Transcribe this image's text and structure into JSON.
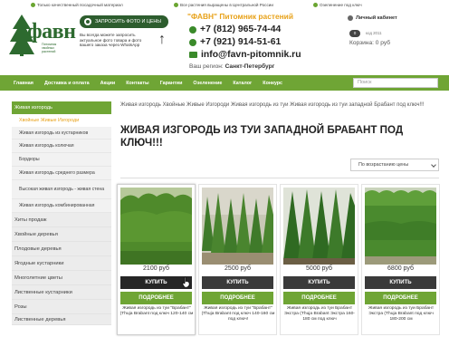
{
  "topbar": {
    "items": [
      "Только качественный посадочный материал",
      "Все растения выращены в Центральной России",
      "Озеленение под ключ"
    ]
  },
  "header": {
    "logo_text": "фавн",
    "logo_sub": "Питомник хвойных растений",
    "whatsapp_button": "ЗАПРОСИТЬ ФОТО И ЦЕНЫ",
    "whatsapp_text": "Вы всегда можете запросить актуальное фото товара и фото вашего заказа через WhatsApp",
    "brand": "\"ФАВН\" Питомник  растений",
    "phone1": "+7 (812) 965-74-44",
    "phone2": "+7 (921) 914-51-61",
    "email": "info@favn-pitomnik.ru",
    "city_label": "Ваш регион:",
    "city": "Санкт-Петербург",
    "cabinet": "Личный кабинет",
    "cart_count": "0",
    "code_label": "код 2011",
    "cart_sum": "Корзина: 0 руб"
  },
  "nav": {
    "items": [
      "Главная",
      "Доставка и оплата",
      "Акции",
      "Контакты",
      "Гарантии",
      "Озеленение",
      "Каталог",
      "Конкурс"
    ],
    "search_placeholder": "Поиск"
  },
  "sidebar": {
    "active": "Живая изгородь",
    "sub_active": "Хвойные Живые Изгороди",
    "subitems": [
      "Живая изгородь из кустарников",
      "Живая изгородь колючая",
      "Бордюры",
      "Живая изгородь среднего размера",
      "Высокая живая изгородь - живая стена",
      "Живая изгородь комбинированная"
    ],
    "items": [
      "Хиты продаж",
      "Хвойные деревья",
      "Плодовые деревья",
      "Ягодные кустарники",
      "Многолетние цветы",
      "Лиственные кустарники",
      "Розы",
      "Лиственные деревья"
    ]
  },
  "main": {
    "breadcrumb": "Живая изгородь Хвойные Живые Изгороди Живая изгородь из туи Живая изгородь из туи западной Брабант под ключ!!!",
    "title": "ЖИВАЯ ИЗГОРОДЬ ИЗ ТУИ ЗАПАДНОЙ БРАБАНТ ПОД КЛЮЧ!!!",
    "sort": "По возрастанию цены",
    "buy_label": "КУПИТЬ",
    "more_label": "ПОДРОБНЕЕ",
    "products": [
      {
        "price": "2100 руб",
        "name": "Живая изгородь из туи \"Брабант\" (Thuja Brabant под ключ 120-140 см"
      },
      {
        "price": "2500 руб",
        "name": "Живая изгородь из туи \"Брабант\" (Thuja Brabant под ключ 140-160 см под ключ!"
      },
      {
        "price": "5000 руб",
        "name": "Живая изгородь из туи Брабант Экстра (Thuja Brabant Экстра 160-180 см под ключ"
      },
      {
        "price": "6800 руб",
        "name": "Живая изгородь из туи Брабант Экстра (Thuja Brabant под ключ 180-200 см"
      }
    ]
  },
  "colors": {
    "accent_green": "#6fa535",
    "dark_green": "#2d5d2e",
    "orange": "#e8a21a"
  }
}
